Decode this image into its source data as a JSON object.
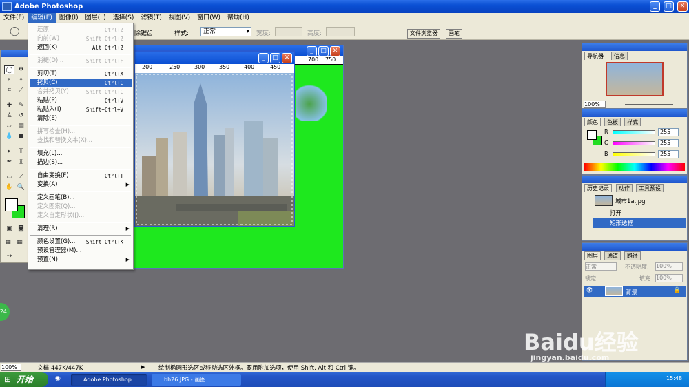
{
  "app": {
    "title": "Adobe Photoshop"
  },
  "menubar": [
    "文件(F)",
    "编辑(E)",
    "图像(I)",
    "图层(L)",
    "选择(S)",
    "滤镜(T)",
    "视图(V)",
    "窗口(W)",
    "帮助(H)"
  ],
  "options": {
    "mode_fragment": "除锯齿",
    "style_label": "样式:",
    "style_value": "正常",
    "width_label": "宽度:",
    "height_label": "高度:",
    "dock_tabs": [
      "文件浏览器",
      "画笔"
    ]
  },
  "edit_menu": [
    {
      "label": "还原",
      "shortcut": "Ctrl+Z",
      "disabled": true
    },
    {
      "label": "向前(W)",
      "shortcut": "Shift+Ctrl+Z",
      "disabled": true
    },
    {
      "label": "返回(K)",
      "shortcut": "Alt+Ctrl+Z",
      "disabled": false
    },
    {
      "sep": true
    },
    {
      "label": "消褪(D)...",
      "shortcut": "Shift+Ctrl+F",
      "disabled": true
    },
    {
      "sep": true
    },
    {
      "label": "剪切(T)",
      "shortcut": "Ctrl+X",
      "disabled": false
    },
    {
      "label": "拷贝(C)",
      "shortcut": "Ctrl+C",
      "disabled": false,
      "highlight": true
    },
    {
      "label": "合并拷贝(Y)",
      "shortcut": "Shift+Ctrl+C",
      "disabled": true
    },
    {
      "label": "粘贴(P)",
      "shortcut": "Ctrl+V",
      "disabled": false
    },
    {
      "label": "粘贴入(I)",
      "shortcut": "Shift+Ctrl+V",
      "disabled": false
    },
    {
      "label": "清除(E)",
      "shortcut": "",
      "disabled": false
    },
    {
      "sep": true
    },
    {
      "label": "拼写检查(H)...",
      "shortcut": "",
      "disabled": true
    },
    {
      "label": "查找和替换文本(X)...",
      "shortcut": "",
      "disabled": true
    },
    {
      "sep": true
    },
    {
      "label": "填充(L)...",
      "shortcut": "",
      "disabled": false
    },
    {
      "label": "描边(S)...",
      "shortcut": "",
      "disabled": false
    },
    {
      "sep": true
    },
    {
      "label": "自由变换(F)",
      "shortcut": "Ctrl+T",
      "disabled": false
    },
    {
      "label": "变换(A)",
      "shortcut": "",
      "disabled": false,
      "submenu": true
    },
    {
      "sep": true
    },
    {
      "label": "定义画笔(B)...",
      "shortcut": "",
      "disabled": false
    },
    {
      "label": "定义图案(Q)...",
      "shortcut": "",
      "disabled": true
    },
    {
      "label": "定义自定形状(J)...",
      "shortcut": "",
      "disabled": true
    },
    {
      "sep": true
    },
    {
      "label": "清理(R)",
      "shortcut": "",
      "disabled": false,
      "submenu": true
    },
    {
      "sep": true
    },
    {
      "label": "颜色设置(G)...",
      "shortcut": "Shift+Ctrl+K",
      "disabled": false
    },
    {
      "label": "预设管理器(M)...",
      "shortcut": "",
      "disabled": false
    },
    {
      "label": "预置(N)",
      "shortcut": "",
      "disabled": false,
      "submenu": true
    }
  ],
  "rulers": {
    "image": [
      "200",
      "250",
      "300",
      "350",
      "400",
      "450"
    ],
    "doc": [
      "700",
      "750"
    ]
  },
  "navigator": {
    "tabs": [
      "导航器",
      "信息"
    ],
    "zoom": "100%"
  },
  "color_panel": {
    "tabs": [
      "颜色",
      "色板",
      "样式"
    ],
    "channels": [
      {
        "name": "R",
        "value": "255"
      },
      {
        "name": "G",
        "value": "255"
      },
      {
        "name": "B",
        "value": "255"
      }
    ],
    "fg": "#ffffff",
    "bg": "#22dd22"
  },
  "history": {
    "tabs": [
      "历史记录",
      "动作",
      "工具预设"
    ],
    "snapshot": "城市1a.jpg",
    "steps": [
      "打开",
      "矩形选框"
    ]
  },
  "layers": {
    "tabs": [
      "图层",
      "通道",
      "路径"
    ],
    "blend": "正常",
    "opacity_label": "不透明度:",
    "opacity": "100%",
    "lock_label": "锁定:",
    "fill_label": "填充:",
    "fill": "100%",
    "layer_name": "背景"
  },
  "status": {
    "zoom": "100%",
    "doc": "文档:447K/447K",
    "hint": "绘制椭圆形选区或移动选区外框。要用附加选项，使用 Shift, Alt 和 Ctrl 键。"
  },
  "taskbar": {
    "start": "开始",
    "tasks": [
      "Adobe Photoshop",
      "bh26.JPG - 画图"
    ],
    "clock": "15:48"
  },
  "watermark": {
    "logo": "Baidu经验",
    "url": "jingyan.baidu.com"
  },
  "badge": "24"
}
